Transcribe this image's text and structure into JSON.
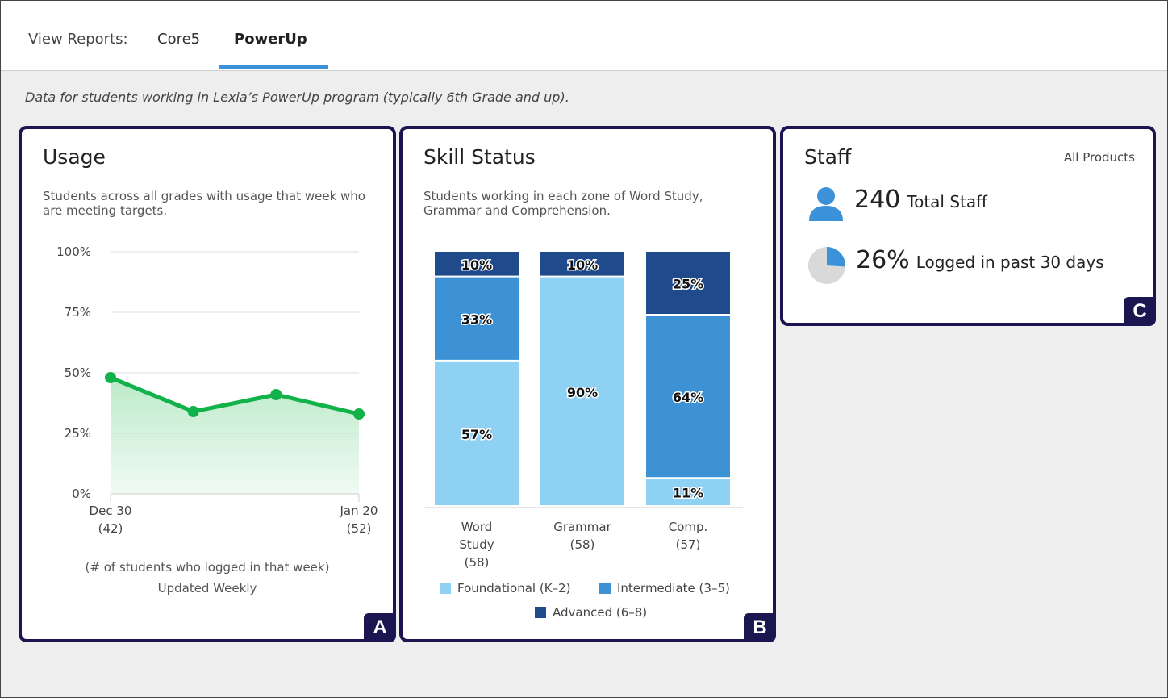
{
  "nav": {
    "label": "View Reports:",
    "tabs": [
      {
        "label": "Core5",
        "active": false
      },
      {
        "label": "PowerUp",
        "active": true
      }
    ]
  },
  "description": "Data for students working in Lexia’s PowerUp program (typically 6th Grade and up).",
  "usage": {
    "title": "Usage",
    "subtitle": "Students across all grades with usage that week who are meeting targets.",
    "badge": "A",
    "footer_line1": "(# of students who logged in that week)",
    "footer_line2": "Updated Weekly",
    "colors": {
      "line": "#11b24a",
      "fill": "#b8e9c6"
    }
  },
  "skill": {
    "title": "Skill Status",
    "subtitle": "Students working in each zone of Word Study, Grammar and Comprehension.",
    "badge": "B",
    "legend": [
      {
        "label": "Foundational (K–2)",
        "color": "#8ed1f2"
      },
      {
        "label": "Intermediate (3–5)",
        "color": "#3c92d4"
      },
      {
        "label": "Advanced (6–8)",
        "color": "#1f4a8c"
      }
    ]
  },
  "staff": {
    "title": "Staff",
    "scope": "All Products",
    "badge": "C",
    "total_value": "240",
    "total_label": "Total Staff",
    "logged_value": "26%",
    "logged_label": "Logged in past 30 days",
    "logged_fraction": 0.26,
    "icons": {
      "person": "person-icon",
      "pie": "pie-icon"
    },
    "colors": {
      "accent": "#3b92d8",
      "pie_bg": "#d9d9d9"
    }
  },
  "chart_data": [
    {
      "type": "area",
      "yticks": [
        "100%",
        "75%",
        "50%",
        "25%",
        "0%"
      ],
      "ylim": [
        0,
        100
      ],
      "x_labels": [
        {
          "date": "Dec 30",
          "count": "(42)"
        },
        {
          "date": "Jan 20",
          "count": "(52)"
        }
      ],
      "values": [
        48,
        34,
        41,
        33
      ],
      "grid": true
    },
    {
      "type": "bar",
      "stacked": true,
      "categories": [
        {
          "name": [
            "Word",
            "Study"
          ],
          "count": "(58)"
        },
        {
          "name": [
            "Grammar"
          ],
          "count": "(58)"
        },
        {
          "name": [
            "Comp."
          ],
          "count": "(57)"
        }
      ],
      "series": [
        {
          "name": "Foundational (K–2)",
          "values": [
            57,
            90,
            11
          ]
        },
        {
          "name": "Intermediate (3–5)",
          "values": [
            33,
            0,
            64
          ]
        },
        {
          "name": "Advanced (6–8)",
          "values": [
            10,
            10,
            25
          ]
        }
      ],
      "labels": [
        [
          "57%",
          "90%",
          "11%"
        ],
        [
          "33%",
          "",
          "64%"
        ],
        [
          "10%",
          "10%",
          "25%"
        ]
      ],
      "ylim": [
        0,
        100
      ]
    }
  ]
}
